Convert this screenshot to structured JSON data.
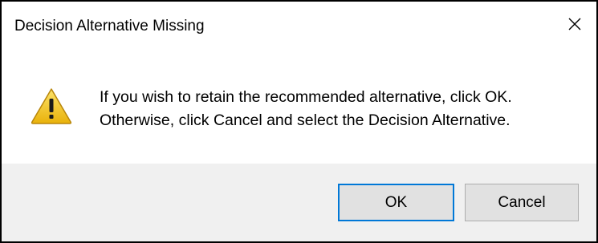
{
  "dialog": {
    "title": "Decision Alternative Missing",
    "close_icon": "close-icon",
    "icon": "warning-icon",
    "message_line1": "If you wish to retain the recommended alternative, click OK.",
    "message_line2": "Otherwise, click Cancel and select the Decision Alternative.",
    "buttons": {
      "ok_label": "OK",
      "cancel_label": "Cancel"
    }
  },
  "colors": {
    "footer_bg": "#f0f0f0",
    "button_bg": "#e1e1e1",
    "default_button_border": "#0078d7",
    "warning_yellow": "#f2c811"
  }
}
